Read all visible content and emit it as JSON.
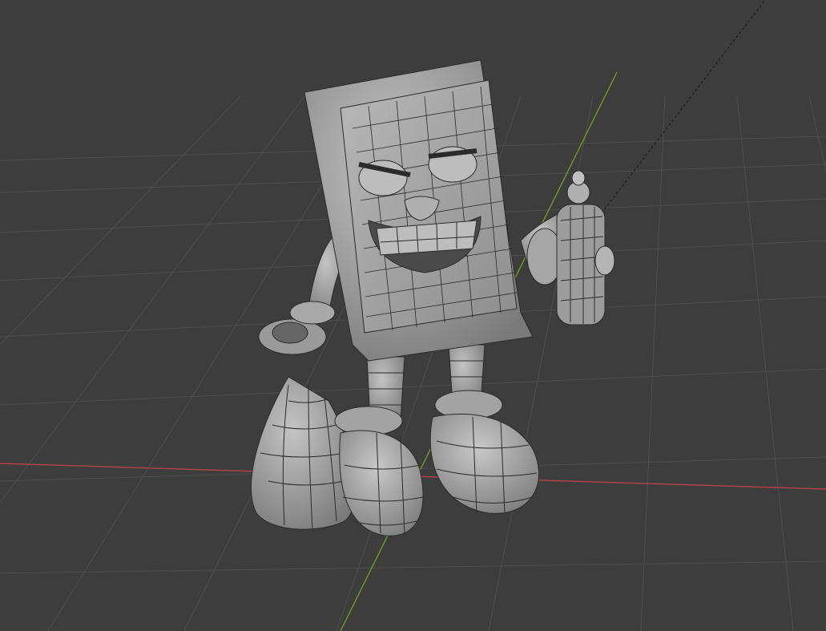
{
  "app": "3D viewport",
  "viewport": {
    "mode": "solid-wireframe-overlay",
    "grid": true,
    "axes": {
      "x_color": "#b5424a",
      "y_color": "#6e9a2a",
      "camera_line": "dashed"
    },
    "colors": {
      "background": "#3d3d3d",
      "grid": "#555555",
      "mesh_fill": "#a6a6a6",
      "mesh_wire": "#2b2b2b"
    }
  },
  "object": {
    "name": "",
    "description_icon": "character-mesh-icon"
  }
}
